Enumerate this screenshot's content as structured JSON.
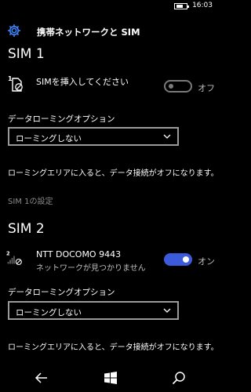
{
  "status_bar": {
    "time": "16:03",
    "battery_icon": "battery-icon"
  },
  "header": {
    "title": "携帯ネットワークと SIM",
    "icon": "gear-icon"
  },
  "sim1": {
    "heading": "SIM 1",
    "slot_number": "1",
    "status": "SIMを挿入してください",
    "toggle_state": "off",
    "toggle_label": "オフ",
    "roaming_label": "データローミングオプション",
    "roaming_value": "ローミングしない",
    "roaming_info": "ローミングエリアに入ると、データ接続がオフになります。",
    "settings_link": "SIM 1の設定"
  },
  "sim2": {
    "heading": "SIM 2",
    "slot_number": "2",
    "carrier": "NTT DOCOMO 9443",
    "status": "ネットワークが見つかりません",
    "toggle_state": "on",
    "toggle_label": "オン",
    "roaming_label": "データローミングオプション",
    "roaming_value": "ローミングしない",
    "roaming_info": "ローミングエリアに入ると、データ接続がオフになります。"
  },
  "nav": {
    "back": "back-icon",
    "home": "windows-icon",
    "search": "search-icon"
  },
  "colors": {
    "accent": "#3b5bdb",
    "background": "#000000"
  }
}
